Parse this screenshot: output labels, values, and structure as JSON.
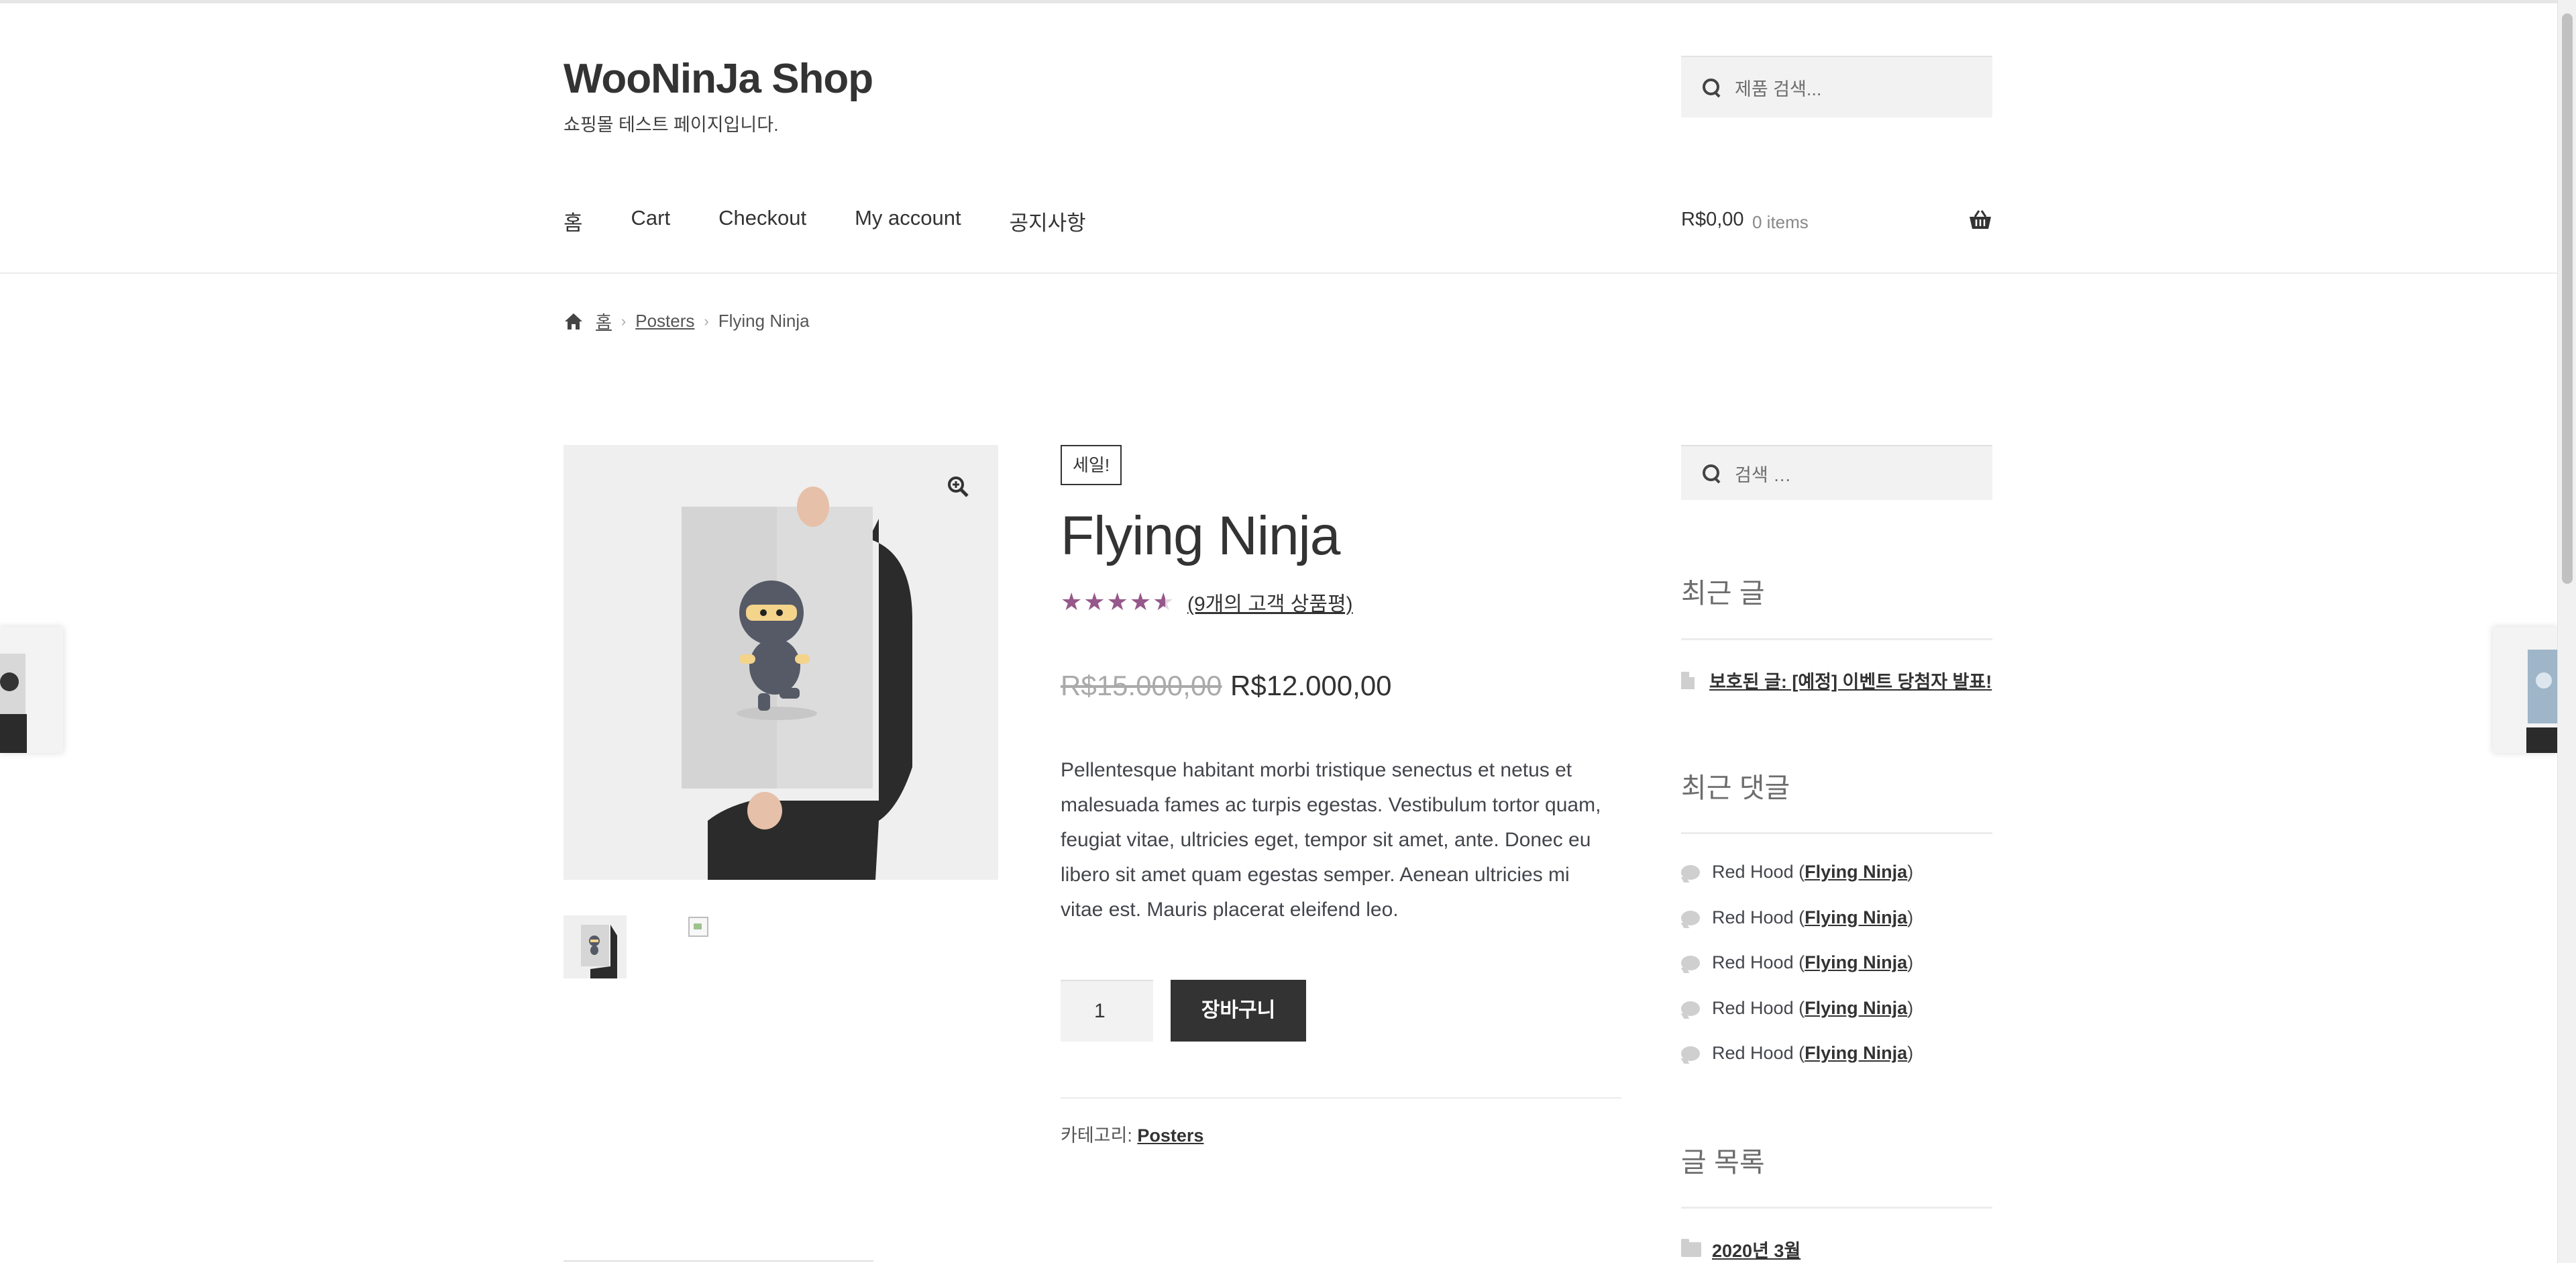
{
  "site": {
    "title": "WooNinJa Shop",
    "description": "쇼핑몰 테스트 페이지입니다."
  },
  "header_search": {
    "placeholder": "제품 검색..."
  },
  "nav": [
    "홈",
    "Cart",
    "Checkout",
    "My account",
    "공지사항"
  ],
  "cart": {
    "total": "R$0,00",
    "count": "0 items"
  },
  "breadcrumb": {
    "home": "홈",
    "category": "Posters",
    "current": "Flying Ninja"
  },
  "product": {
    "sale_badge": "세일!",
    "title": "Flying Ninja",
    "rating": 4.56,
    "rating_max": 5,
    "review_link": "(9개의 고객 상품평)",
    "price_old": "R$15.000,00",
    "price_new": "R$12.000,00",
    "description": "Pellentesque habitant morbi tristique senectus et netus et malesuada fames ac turpis egestas. Vestibulum tortor quam, feugiat vitae, ultricies eget, tempor sit amet, ante. Donec eu libero sit amet quam egestas semper. Aenean ultricies mi vitae est. Mauris placerat eleifend leo.",
    "quantity": "1",
    "add_to_cart": "장바구니",
    "category_label": "카테고리:",
    "category": "Posters"
  },
  "sidebar": {
    "search_placeholder": "검색 …",
    "recent_posts_title": "최근 글",
    "recent_post": "보호된 글: [예정] 이벤트 당첨자 발표!",
    "recent_comments_title": "최근 댓글",
    "comments": [
      {
        "author": "Red Hood",
        "post": "Flying Ninja"
      },
      {
        "author": "Red Hood",
        "post": "Flying Ninja"
      },
      {
        "author": "Red Hood",
        "post": "Flying Ninja"
      },
      {
        "author": "Red Hood",
        "post": "Flying Ninja"
      },
      {
        "author": "Red Hood",
        "post": "Flying Ninja"
      }
    ],
    "archives_title": "글 목록",
    "archive": "2020년 3월"
  },
  "colors": {
    "accent": "#96588a",
    "button": "#333333",
    "text": "#43454b"
  }
}
